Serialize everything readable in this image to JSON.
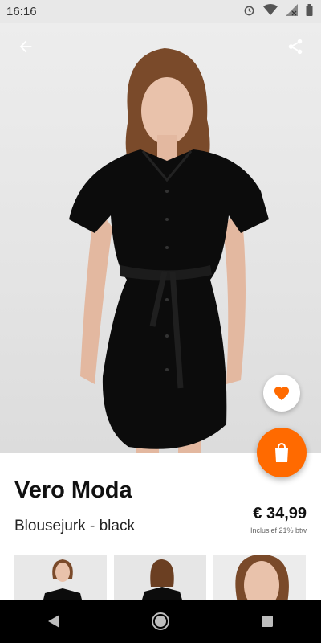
{
  "status": {
    "time": "16:16",
    "icons": [
      "alarm-icon",
      "wifi-icon",
      "signal-icon",
      "battery-icon"
    ]
  },
  "hero": {
    "image": "product-photo-black-shirt-dress",
    "icons": {
      "back": "arrow-left-icon",
      "share": "share-icon"
    }
  },
  "actions": {
    "favorite_icon": "heart-icon",
    "cart_icon": "shopping-bag-icon",
    "accent_color": "#ff6a00"
  },
  "product": {
    "brand": "Vero Moda",
    "name": "Blousejurk - black",
    "price": "€ 34,99",
    "vat_note": "Inclusief 21% btw"
  },
  "thumbnails": [
    "thumb-front-view",
    "thumb-back-view",
    "thumb-detail-view"
  ],
  "navbar": {
    "icons": [
      "nav-back-icon",
      "nav-home-icon",
      "nav-recents-icon"
    ]
  }
}
